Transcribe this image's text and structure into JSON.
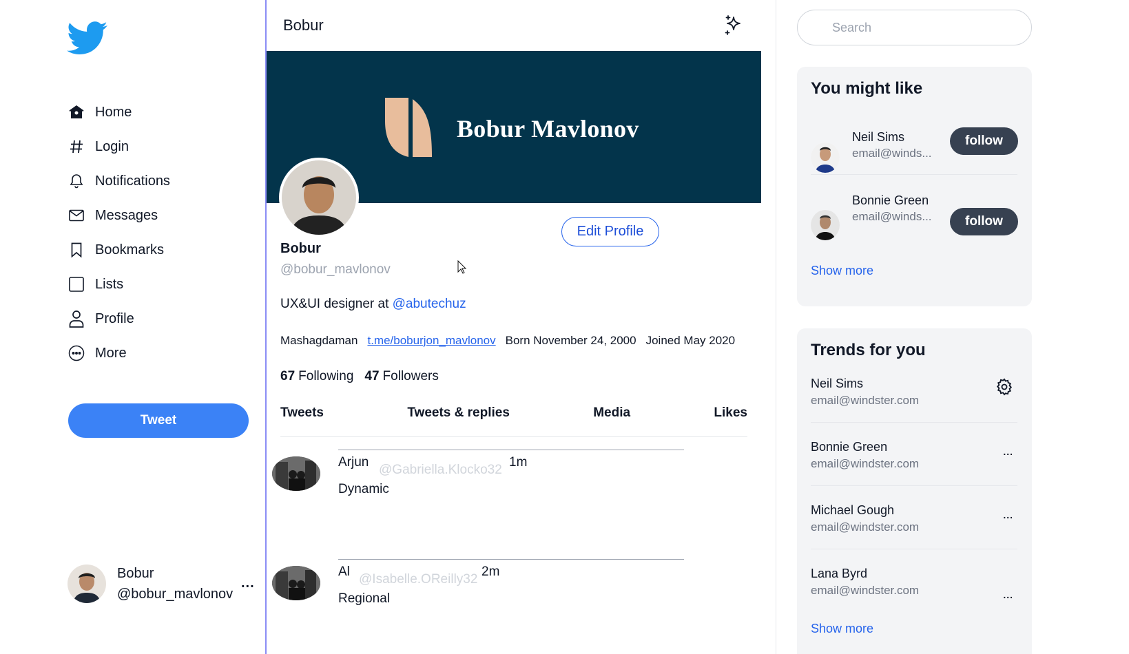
{
  "nav": {
    "items": [
      {
        "label": "Home",
        "icon": "home-icon"
      },
      {
        "label": "Login",
        "icon": "hashtag-icon"
      },
      {
        "label": "Notifications",
        "icon": "bell-icon"
      },
      {
        "label": "Messages",
        "icon": "mail-icon"
      },
      {
        "label": "Bookmarks",
        "icon": "bookmark-icon"
      },
      {
        "label": "Lists",
        "icon": "list-icon"
      },
      {
        "label": "Profile",
        "icon": "user-icon"
      },
      {
        "label": "More",
        "icon": "more-circle-icon"
      }
    ],
    "tweet_button": "Tweet",
    "account": {
      "name": "Bobur",
      "handle": "@bobur_mavlonov",
      "menu": "..."
    }
  },
  "header": {
    "title": "Bobur"
  },
  "banner": {
    "title": "Bobur Mavlonov"
  },
  "profile": {
    "edit_button": "Edit Profile",
    "name": "Bobur",
    "handle": "@bobur_mavlonov",
    "bio_prefix": "UX&UI designer at",
    "bio_mention": "@abutechuz",
    "location": "Mashagdaman",
    "link": "t.me/boburjon_mavlonov",
    "born": "Born November 24, 2000",
    "joined": "Joined May 2020",
    "following_count": "67",
    "following_label": "Following",
    "followers_count": "47",
    "followers_label": "Followers"
  },
  "tabs": [
    "Tweets",
    "Tweets & replies",
    "Media",
    "Likes"
  ],
  "tweets": [
    {
      "author": "Arjun",
      "handle": "@Gabriella.Klocko32",
      "time": "1m",
      "text": "Dynamic"
    },
    {
      "author": "Al",
      "handle": "@Isabelle.OReilly32",
      "time": "2m",
      "text": "Regional"
    }
  ],
  "search": {
    "placeholder": "Search"
  },
  "suggestions": {
    "title": "You might like",
    "items": [
      {
        "name": "Neil Sims",
        "email": "email@winds...",
        "button": "follow"
      },
      {
        "name": "Bonnie Green",
        "email": "email@winds...",
        "button": "follow"
      }
    ],
    "show_more": "Show more"
  },
  "trends": {
    "title": "Trends for you",
    "items": [
      {
        "name": "Neil Sims",
        "email": "email@windster.com"
      },
      {
        "name": "Bonnie Green",
        "email": "email@windster.com",
        "menu": "..."
      },
      {
        "name": "Michael Gough",
        "email": "email@windster.com",
        "menu": "..."
      },
      {
        "name": "Lana Byrd",
        "email": "email@windster.com",
        "menu": "..."
      }
    ],
    "show_more": "Show more"
  },
  "colors": {
    "brand_blue": "#1d9bf0",
    "tweet_button": "#3b82f6",
    "link": "#2563eb",
    "banner": "#03344b",
    "banner_accent": "#e8bd9c",
    "follow_button": "#374151",
    "card_bg": "#f3f4f6"
  }
}
